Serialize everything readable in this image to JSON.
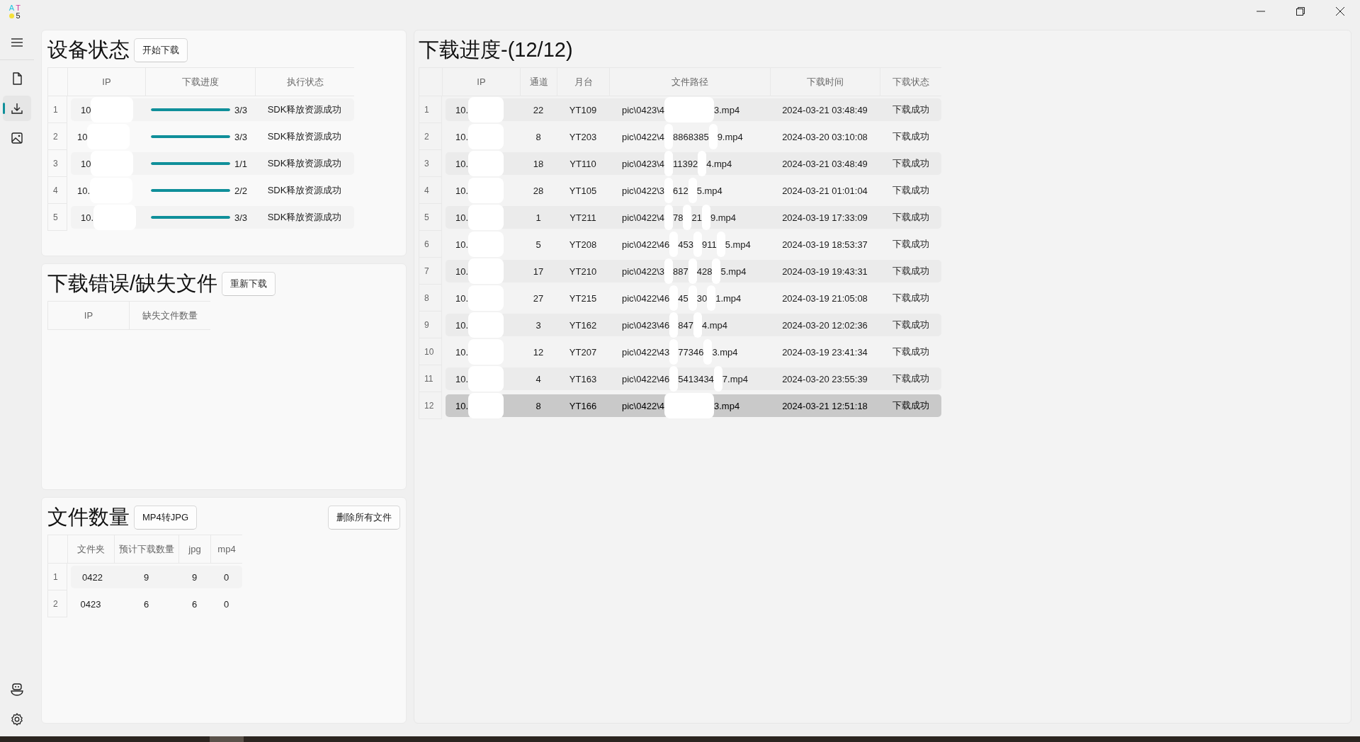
{
  "app": {
    "logo": [
      "A",
      "T",
      "5"
    ]
  },
  "sidebar": {
    "items": [
      {
        "kind": "file",
        "selected": false
      },
      {
        "kind": "download",
        "selected": true
      },
      {
        "kind": "image",
        "selected": false
      }
    ],
    "bottom_items": [
      {
        "kind": "robot"
      },
      {
        "kind": "settings"
      }
    ]
  },
  "device_panel": {
    "title": "设备状态",
    "button": "开始下载",
    "columns": [
      "IP",
      "下载进度",
      "执行状态"
    ],
    "rows": [
      {
        "index": "1",
        "ip": "10",
        "level": 1,
        "progress": "3/3",
        "status": "SDK释放资源成功"
      },
      {
        "index": "2",
        "ip": "10",
        "level": 1,
        "progress": "3/3",
        "status": "SDK释放资源成功"
      },
      {
        "index": "3",
        "ip": "10",
        "level": 1,
        "progress": "1/1",
        "status": "SDK释放资源成功"
      },
      {
        "index": "4",
        "ip": "10.",
        "level": 1,
        "progress": "2/2",
        "status": "SDK释放资源成功"
      },
      {
        "index": "5",
        "ip": "10.",
        "level": 1,
        "progress": "3/3",
        "status": "SDK释放资源成功"
      }
    ]
  },
  "error_panel": {
    "title": "下载错误/缺失文件",
    "button": "重新下载",
    "columns": [
      "IP",
      "缺失文件数量"
    ]
  },
  "file_panel": {
    "title": "文件数量",
    "button": "MP4转JPG",
    "right_button": "删除所有文件",
    "columns": [
      "文件夹",
      "预计下载数量",
      "jpg",
      "mp4"
    ],
    "rows": [
      {
        "index": "1",
        "cells": [
          "0422",
          "9",
          "9",
          "0"
        ]
      },
      {
        "index": "2",
        "cells": [
          "0423",
          "6",
          "6",
          "0"
        ]
      }
    ]
  },
  "download_panel": {
    "title": "下载进度-(12/12)",
    "columns": [
      "IP",
      "通道",
      "月台",
      "文件路径",
      "下载时间",
      "下载状态"
    ],
    "rows": [
      {
        "index": "1",
        "ip": "10.",
        "channel": "22",
        "platform": "YT109",
        "path": [
          "pic\\0423\\4",
          "3.mp4"
        ],
        "time": "2024-03-21 03:48:49",
        "status": "下载成功",
        "selected": false
      },
      {
        "index": "2",
        "ip": "10.",
        "channel": "8",
        "platform": "YT203",
        "path": [
          "pic\\0422\\4",
          "8868385",
          "9.mp4"
        ],
        "time": "2024-03-20 03:10:08",
        "status": "下载成功",
        "selected": false
      },
      {
        "index": "3",
        "ip": "10.",
        "channel": "18",
        "platform": "YT110",
        "path": [
          "pic\\0423\\4",
          "11392",
          "4.mp4"
        ],
        "time": "2024-03-21 03:48:49",
        "status": "下载成功",
        "selected": false
      },
      {
        "index": "4",
        "ip": "10.",
        "channel": "28",
        "platform": "YT105",
        "path": [
          "pic\\0422\\3",
          "612",
          "5.mp4"
        ],
        "time": "2024-03-21 01:01:04",
        "status": "下载成功",
        "selected": false
      },
      {
        "index": "5",
        "ip": "10.",
        "channel": "1",
        "platform": "YT211",
        "path": [
          "pic\\0422\\4",
          "78",
          "21",
          "9.mp4"
        ],
        "time": "2024-03-19 17:33:09",
        "status": "下载成功",
        "selected": false
      },
      {
        "index": "6",
        "ip": "10.",
        "channel": "5",
        "platform": "YT208",
        "path": [
          "pic\\0422\\46",
          "453",
          "911",
          "5.mp4"
        ],
        "time": "2024-03-19 18:53:37",
        "status": "下载成功",
        "selected": false
      },
      {
        "index": "7",
        "ip": "10.",
        "channel": "17",
        "platform": "YT210",
        "path": [
          "pic\\0422\\3",
          "887",
          "428",
          "5.mp4"
        ],
        "time": "2024-03-19 19:43:31",
        "status": "下载成功",
        "selected": false
      },
      {
        "index": "8",
        "ip": "10.",
        "channel": "27",
        "platform": "YT215",
        "path": [
          "pic\\0422\\46",
          "45",
          "30",
          "1.mp4"
        ],
        "time": "2024-03-19 21:05:08",
        "status": "下载成功",
        "selected": false
      },
      {
        "index": "9",
        "ip": "10.",
        "channel": "3",
        "platform": "YT162",
        "path": [
          "pic\\0423\\46",
          "847",
          "4.mp4"
        ],
        "time": "2024-03-20 12:02:36",
        "status": "下载成功",
        "selected": false
      },
      {
        "index": "10",
        "ip": "10.",
        "channel": "12",
        "platform": "YT207",
        "path": [
          "pic\\0422\\43",
          "77346",
          "3.mp4"
        ],
        "time": "2024-03-19 23:41:34",
        "status": "下载成功",
        "selected": false
      },
      {
        "index": "11",
        "ip": "10.",
        "channel": "4",
        "platform": "YT163",
        "path": [
          "pic\\0422\\46",
          "5413434",
          "7.mp4"
        ],
        "time": "2024-03-20 23:55:39",
        "status": "下载成功",
        "selected": false
      },
      {
        "index": "12",
        "ip": "10.",
        "channel": "8",
        "platform": "YT166",
        "path": [
          "pic\\0422\\4",
          "3.mp4"
        ],
        "time": "2024-03-21 12:51:18",
        "status": "下载成功",
        "selected": true
      }
    ]
  }
}
